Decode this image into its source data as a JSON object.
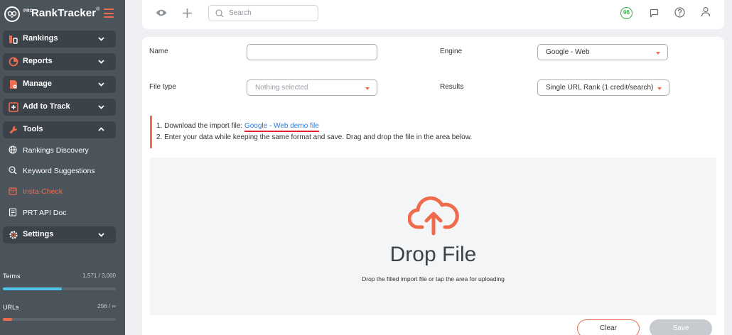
{
  "app": {
    "logo_prefix": "PRO",
    "logo_name": "RankTracker",
    "logo_mark": "®"
  },
  "sidebar": {
    "groups": [
      {
        "label": "Rankings",
        "icon": "rankings-bar-icon",
        "expanded": false
      },
      {
        "label": "Reports",
        "icon": "reports-pie-icon",
        "expanded": false
      },
      {
        "label": "Manage",
        "icon": "manage-document-icon",
        "expanded": false
      },
      {
        "label": "Add to Track",
        "icon": "add-square-icon",
        "expanded": false
      },
      {
        "label": "Tools",
        "icon": "tools-wrench-icon",
        "expanded": true
      },
      {
        "label": "Settings",
        "icon": "settings-gear-icon",
        "expanded": false
      }
    ],
    "tools_items": [
      {
        "label": "Rankings Discovery",
        "icon": "globe-icon",
        "active": false
      },
      {
        "label": "Keyword Suggestions",
        "icon": "keyword-search-icon",
        "active": false
      },
      {
        "label": "Insta-Check",
        "icon": "calendar-icon",
        "active": true
      },
      {
        "label": "PRT API Doc",
        "icon": "api-document-icon",
        "active": false
      }
    ],
    "usage": {
      "terms_label": "Terms",
      "terms_count": "1,571 / 3,000",
      "terms_fraction": 0.52,
      "urls_label": "URLs",
      "urls_count": "256 / ∞",
      "urls_fraction": 0.08
    }
  },
  "topbar": {
    "search_placeholder": "Search",
    "credits_badge": "96",
    "icons": [
      "eye-icon",
      "plus-icon",
      "search-icon",
      "chat-flag-icon",
      "help-circle-icon",
      "user-icon"
    ]
  },
  "form": {
    "name_label": "Name",
    "name_value": "",
    "engine_label": "Engine",
    "engine_value": "Google - Web",
    "file_type_label": "File type",
    "file_type_placeholder": "Nothing selected",
    "results_label": "Results",
    "results_value": "Single URL Rank (1 credit/search)"
  },
  "instructions": {
    "line1_prefix": "1. Download the import file: ",
    "line1_link": "Google - Web demo file",
    "line2": "2. Enter your data while keeping the same format and save. Drag and drop the file in the area below."
  },
  "dropzone": {
    "title": "Drop File",
    "subtitle": "Drop the filled import file or tap the area for uploading"
  },
  "actions": {
    "clear_label": "Clear",
    "save_label": "Save"
  },
  "colors": {
    "accent": "#ee6c4d",
    "sidebar_bg": "#4b535b",
    "sidebar_group_bg": "#3b4249",
    "link": "#2c7bd4",
    "credit_green": "#3bb04c",
    "terms_bar": "#4fc3e8",
    "urls_bar": "#ee6c4d"
  }
}
